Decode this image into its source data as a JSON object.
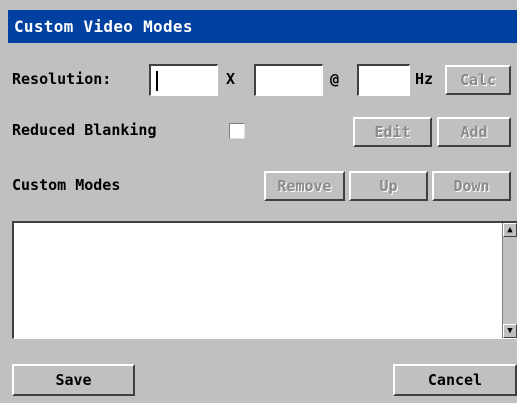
{
  "window": {
    "title": "Custom Video Modes"
  },
  "resolution": {
    "label": "Resolution:",
    "width_value": "",
    "separator_x": "X",
    "height_value": "",
    "separator_at": "@",
    "refresh_value": "",
    "unit_hz": "Hz",
    "calc_label": "Calc"
  },
  "blanking": {
    "label": "Reduced Blanking",
    "checked": false,
    "edit_label": "Edit",
    "add_label": "Add"
  },
  "custom_modes": {
    "label": "Custom Modes",
    "remove_label": "Remove",
    "up_label": "Up",
    "down_label": "Down",
    "items": []
  },
  "footer": {
    "save_label": "Save",
    "cancel_label": "Cancel"
  },
  "colors": {
    "title_bar": "#0040a0",
    "panel": "#c0c0c0",
    "disabled_text": "#8a8a8a"
  },
  "icons": {
    "scroll_up": "triangle-up-icon",
    "scroll_down": "triangle-down-icon"
  }
}
